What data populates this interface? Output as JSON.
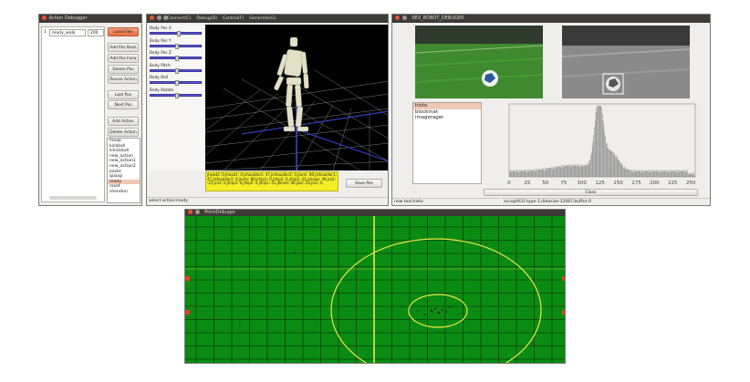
{
  "action_debugger": {
    "title": "Action Debugger",
    "row_index": "1",
    "action_name": "ready_walk",
    "action_value": "200",
    "buttons": {
      "load_files": "Load Files",
      "add_pos_back": "Add Pos Back",
      "add_pos_forw": "Add Pos Forw",
      "delete_pos": "Delete Pos",
      "revise_action": "Revise Action",
      "last_pos": "Last Pos",
      "next_pos": "Next Pos",
      "add_action": "Add Action",
      "delete_action": "Delete Action"
    },
    "actions": [
      "houqi",
      "kickball",
      "lckickball",
      "new_action",
      "new_action1",
      "new_action2",
      "paste",
      "qiaoqi",
      "ready",
      "reset",
      "shendun"
    ],
    "selected_action": "ready"
  },
  "robot_viewer": {
    "menu": [
      "Connect(C)",
      "Debug(D)",
      "Control(F)",
      "Generate(G)"
    ],
    "sliders": [
      {
        "label": "Body Pos X",
        "level": 0.55
      },
      {
        "label": "Body Pos Y",
        "level": 0.5
      },
      {
        "label": "Body Pos Z",
        "level": 0.5
      },
      {
        "label": "Body Pitch",
        "level": 0.5
      },
      {
        "label": "Body Roll",
        "level": 0.5
      },
      {
        "label": "Body Rotate",
        "level": 0.5
      }
    ],
    "joint_values": "jhead2: 0,jhead1: 0,jshoulder1: 47,jrshoulder2: 0,jlarm: 89,jlshoulder1: 47,jlshoulder2: 0,jlarm: 89,jrhip3: 0,jrhip2: 0,jrhip1:-31,jrknee: 46,jra2:-23,jra1: 0,jlhip3: 0,jlhip2: 0,jlhip1:-31,jlknee: 46,jla2:-23,jla1: 0,",
    "save_pos": "Save Pos",
    "status": "select action:ready"
  },
  "seu_debugger": {
    "title": "SEU_ROBOT_DEBUGER",
    "tools": [
      "histo",
      "blockmat",
      "imagerager"
    ],
    "selected_tool": "histo",
    "x_ticks": [
      "0",
      "25",
      "50",
      "75",
      "100",
      "125",
      "150",
      "175",
      "200",
      "225",
      "250"
    ],
    "close_label": "Close",
    "status_left": "now tool:histo",
    "status_right": "accept931:type-1,datasize-12087,buffsn-0"
  },
  "point_debugger": {
    "title": "PointDebuger"
  },
  "colors": {
    "field_green": "#0a8c12",
    "field_line": "#e8e84a",
    "accent_orange": "#ea6b3f",
    "slider_blue": "#5a55c8",
    "joint_panel": "#f3ee26"
  }
}
